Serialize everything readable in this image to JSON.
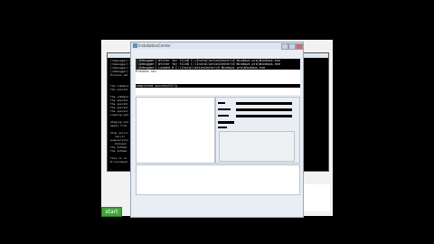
{
  "console": {
    "lines": [
      "[\\Debugger] Writer for file0 C:\\InstallationCenter\\6 Windows pro\\Windows.exe",
      "[\\Debugger] Writer for file0 C:\\InstallationCenter\\6 Windows pro\\Windows.exe",
      "[\\Debugger] Writer for file0 C:\\InstallationCenter\\6 Windows pro\\Windows.exe",
      "[\\Debugger] Loaded 0 C:\\InstallationCenter\\6 Windows pro\\Windows.exe",
      "Process sel",
      "",
      "",
      "The command",
      "The operati",
      "",
      "The command",
      "The operati",
      "The operati",
      "The operati",
      "The operati",
      "Loading upd",
      "",
      "Staging upd",
      "Apply from",
      "",
      "Stop servic",
      "   Servic",
      "wuauserv=un",
      "   Unknown",
      "The IntDem",
      "The IntDem",
      "",
      "This is co",
      "R:\\windows\\"
    ]
  },
  "dialog": {
    "title": "InstallationCenter",
    "output": {
      "lines": [
        "[\\Debugger] Writer for file0 C:\\InstallationCenter\\6 Windows pro\\Windows.exe",
        "[\\Debugger] Writer for file0 C:\\InstallationCenter\\6 Windows pro\\Windows.exe",
        "[\\Debugger] Loaded 0 C:\\InstallationCenter\\6 Windows pro\\Windows.exe",
        "Process sel",
        "",
        "",
        "",
        "completed successfully"
      ]
    }
  },
  "taskbar": {
    "start_label": "start"
  },
  "colors": {
    "console_bg": "#000000",
    "dialog_bg": "#e9eef4",
    "start_green": "#3fa63a"
  }
}
